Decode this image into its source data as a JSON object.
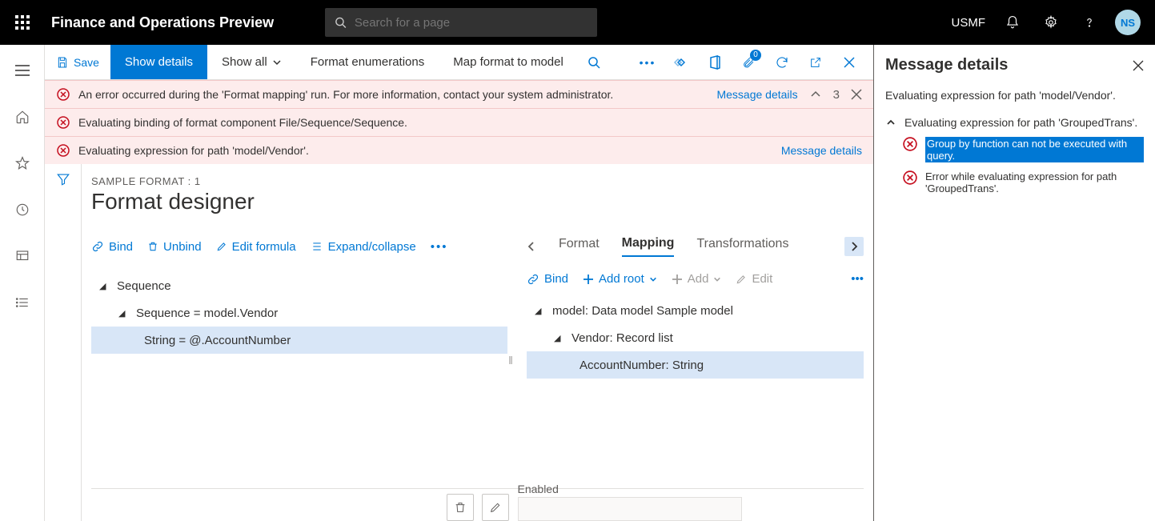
{
  "appbar": {
    "title": "Finance and Operations Preview",
    "search_placeholder": "Search for a page",
    "company": "USMF",
    "avatar": "NS"
  },
  "cmdbar": {
    "save": "Save",
    "show_details": "Show details",
    "show_all": "Show all",
    "format_enum": "Format enumerations",
    "map_format": "Map format to model",
    "attach_badge": "0"
  },
  "messages": {
    "items": [
      "An error occurred during the 'Format mapping' run. For more information, contact your system administrator.",
      "Evaluating binding of format component File/Sequence/Sequence.",
      "Evaluating expression for path 'model/Vendor'."
    ],
    "details_link": "Message details",
    "count": "3"
  },
  "designer": {
    "breadcrumb": "SAMPLE FORMAT : 1",
    "title": "Format designer",
    "left_toolbar": {
      "bind": "Bind",
      "unbind": "Unbind",
      "edit_formula": "Edit formula",
      "expand": "Expand/collapse"
    },
    "left_tree": {
      "n0": "Sequence",
      "n1": "Sequence = model.Vendor",
      "n2": "String = @.AccountNumber"
    },
    "tabs": {
      "format": "Format",
      "mapping": "Mapping",
      "transformations": "Transformations"
    },
    "right_toolbar": {
      "bind": "Bind",
      "add_root": "Add root",
      "add": "Add",
      "edit": "Edit"
    },
    "right_tree": {
      "n0": "model: Data model Sample model",
      "n1": "Vendor: Record list",
      "n2": "AccountNumber: String"
    },
    "bottom": {
      "enabled": "Enabled"
    }
  },
  "side": {
    "title": "Message details",
    "subtitle": "Evaluating expression for path 'model/Vendor'.",
    "group_head": "Evaluating expression for path 'GroupedTrans'.",
    "item1": "Group by function can not be executed with query.",
    "item2": "Error while evaluating expression for path 'GroupedTrans'."
  }
}
